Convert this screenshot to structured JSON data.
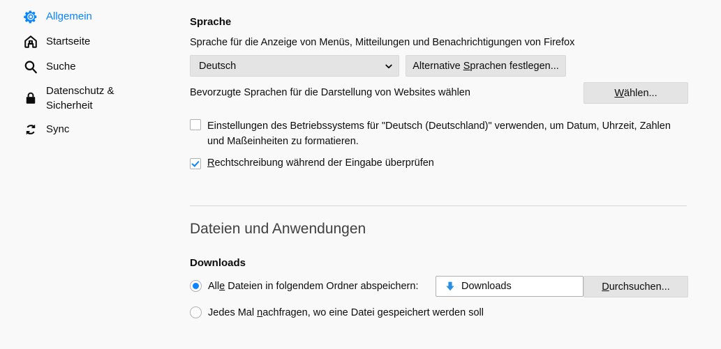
{
  "sidebar": {
    "items": [
      {
        "id": "allgemein",
        "label": "Allgemein",
        "icon": "gear-icon",
        "selected": true
      },
      {
        "id": "startseite",
        "label": "Startseite",
        "icon": "home-icon",
        "selected": false
      },
      {
        "id": "suche",
        "label": "Suche",
        "icon": "search-icon",
        "selected": false
      },
      {
        "id": "datenschutz",
        "label": "Datenschutz &\nSicherheit",
        "icon": "lock-icon",
        "selected": false
      },
      {
        "id": "sync",
        "label": "Sync",
        "icon": "sync-icon",
        "selected": false
      }
    ]
  },
  "language_section": {
    "title": "Sprache",
    "description": "Sprache für die Anzeige von Menüs, Mitteilungen und Benachrichtigungen von Firefox",
    "dropdown": {
      "value": "Deutsch",
      "icon": "chevron-down-icon"
    },
    "alternative_button": {
      "prefix": "Alternative ",
      "accesskey": "S",
      "suffix": "prachen festlegen..."
    },
    "websites_label": "Bevorzugte Sprachen für die Darstellung von Websites wählen",
    "choose_button": {
      "prefix": "",
      "accesskey": "W",
      "suffix": "ählen..."
    },
    "os_checkbox": {
      "checked": false,
      "label": "Einstellungen des Betriebssystems für \"Deutsch (Deutschland)\" verwenden, um Datum, Uhrzeit, Zahlen und Maßeinheiten zu formatieren."
    },
    "spellcheck_checkbox": {
      "checked": true,
      "prefix": "",
      "accesskey": "R",
      "suffix": "echtschreibung während der Eingabe überprüfen"
    }
  },
  "files_section": {
    "heading": "Dateien und Anwendungen",
    "downloads_title": "Downloads",
    "radio_save_folder": {
      "selected": true,
      "prefix": "All",
      "accesskey": "e",
      "suffix": " Dateien in folgendem Ordner abspeichern:"
    },
    "folder_field": {
      "value": "Downloads",
      "icon": "download-arrow-icon"
    },
    "browse_button": {
      "prefix": "",
      "accesskey": "D",
      "suffix": "urchsuchen..."
    },
    "radio_always_ask": {
      "selected": false,
      "prefix": "Jedes Mal ",
      "accesskey": "n",
      "suffix": "achfragen, wo eine Datei gespeichert werden soll"
    }
  },
  "colors": {
    "accent": "#0a84ff",
    "background": "#f9f9fa",
    "button_bg": "#e4e4e4",
    "divider": "#d7d7db",
    "text": "#0c0c0d"
  }
}
